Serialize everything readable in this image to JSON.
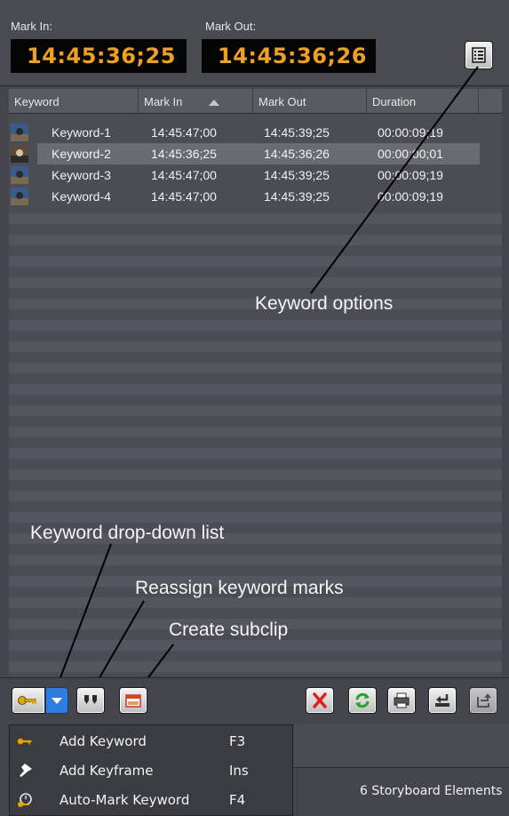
{
  "marks": {
    "in_label": "Mark In:",
    "in_value": "14:45:36;25",
    "out_label": "Mark Out:",
    "out_value": "14:45:36;26"
  },
  "table": {
    "columns": [
      "Keyword",
      "Mark In",
      "Mark Out",
      "Duration"
    ],
    "sort_column": "Mark In",
    "rows": [
      {
        "keyword": "Keyword-1",
        "mark_in": "14:45:47;00",
        "mark_out": "14:45:39;25",
        "duration": "00:00:09;19",
        "selected": false
      },
      {
        "keyword": "Keyword-2",
        "mark_in": "14:45:36;25",
        "mark_out": "14:45:36;26",
        "duration": "00:00:00;01",
        "selected": true
      },
      {
        "keyword": "Keyword-3",
        "mark_in": "14:45:47;00",
        "mark_out": "14:45:39;25",
        "duration": "00:00:09;19",
        "selected": false
      },
      {
        "keyword": "Keyword-4",
        "mark_in": "14:45:47;00",
        "mark_out": "14:45:39;25",
        "duration": "00:00:09;19",
        "selected": false
      }
    ]
  },
  "callouts": {
    "keyword_options": "Keyword options",
    "dropdown": "Keyword drop-down list",
    "reassign": "Reassign keyword marks",
    "subclip": "Create subclip"
  },
  "menu": {
    "items": [
      {
        "label": "Add Keyword",
        "shortcut": "F3",
        "icon": "key-icon"
      },
      {
        "label": "Add Keyframe",
        "shortcut": "Ins",
        "icon": "pin-icon"
      },
      {
        "label": "Auto-Mark Keyword",
        "shortcut": "F4",
        "icon": "auto-mark-icon"
      }
    ]
  },
  "status": {
    "storyboard_text": "6 Storyboard Elements"
  },
  "colors": {
    "timecode": "#f0a020",
    "panel": "#45454d",
    "accent_blue": "#2f7de0",
    "delete_red": "#e02020",
    "refresh_green": "#2aa02a"
  }
}
